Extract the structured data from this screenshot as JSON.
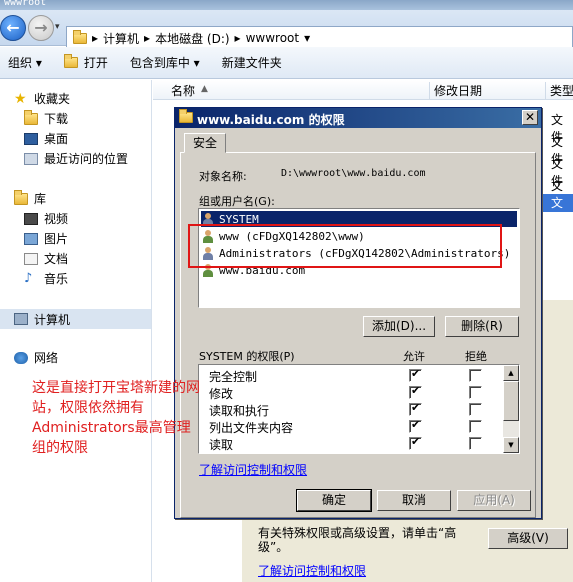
{
  "window": {
    "title": "wwwroot"
  },
  "nav": {
    "breadcrumb": [
      "计算机",
      "本地磁盘 (D:)",
      "wwwroot"
    ],
    "separator": "▸",
    "dropdown_glyph": "▾"
  },
  "toolbar": {
    "organize": "组织 ▾",
    "open": "打开",
    "include_library": "包含到库中 ▾",
    "new_folder": "新建文件夹"
  },
  "sidebar": {
    "favorites": "收藏夹",
    "downloads": "下载",
    "desktop": "桌面",
    "recent": "最近访问的位置",
    "libraries": "库",
    "videos": "视频",
    "pictures": "图片",
    "documents": "文档",
    "music": "音乐",
    "computer": "计算机",
    "network": "网络"
  },
  "filelist": {
    "columns": [
      "名称",
      "修改日期",
      "类型"
    ],
    "type_values": [
      "文件",
      "文件",
      "文件",
      "文件",
      "文件"
    ]
  },
  "dialog": {
    "title": "www.baidu.com 的权限",
    "close": "✕",
    "tab": "安全",
    "object_label": "对象名称:",
    "object_value": "D:\\wwwroot\\www.baidu.com",
    "groups_label": "组或用户名(G):",
    "users": [
      "SYSTEM",
      "www (cFDgXQ142802\\www)",
      "Administrators (cFDgXQ142802\\Administrators)",
      "www.baidu.com"
    ],
    "add_button": "添加(D)...",
    "remove_button": "删除(R)",
    "perm_header": "SYSTEM 的权限(P)",
    "allow_header": "允许",
    "deny_header": "拒绝",
    "permissions": [
      {
        "name": "完全控制",
        "allow": true,
        "deny": false
      },
      {
        "name": "修改",
        "allow": true,
        "deny": false
      },
      {
        "name": "读取和执行",
        "allow": true,
        "deny": false
      },
      {
        "name": "列出文件夹内容",
        "allow": true,
        "deny": false
      },
      {
        "name": "读取",
        "allow": true,
        "deny": false
      }
    ],
    "learn_link": "了解访问控制和权限",
    "ok_button": "确定",
    "cancel_button": "取消",
    "apply_button": "应用(A)"
  },
  "behind": {
    "advanced_text": "有关特殊权限或高级设置，请单击“高级”。",
    "advanced_button": "高级(V)",
    "learn_link": "了解访问控制和权限"
  },
  "annotation": "这是直接打开宝塔新建的网站，权限依然拥有Administrators最高管理组的权限",
  "colors": {
    "annotation": "#e02020",
    "highlight_box": "#e01515",
    "dialog_title_start": "#0a246a",
    "dialog_face": "#d4d0c8",
    "link": "#0000ff"
  }
}
